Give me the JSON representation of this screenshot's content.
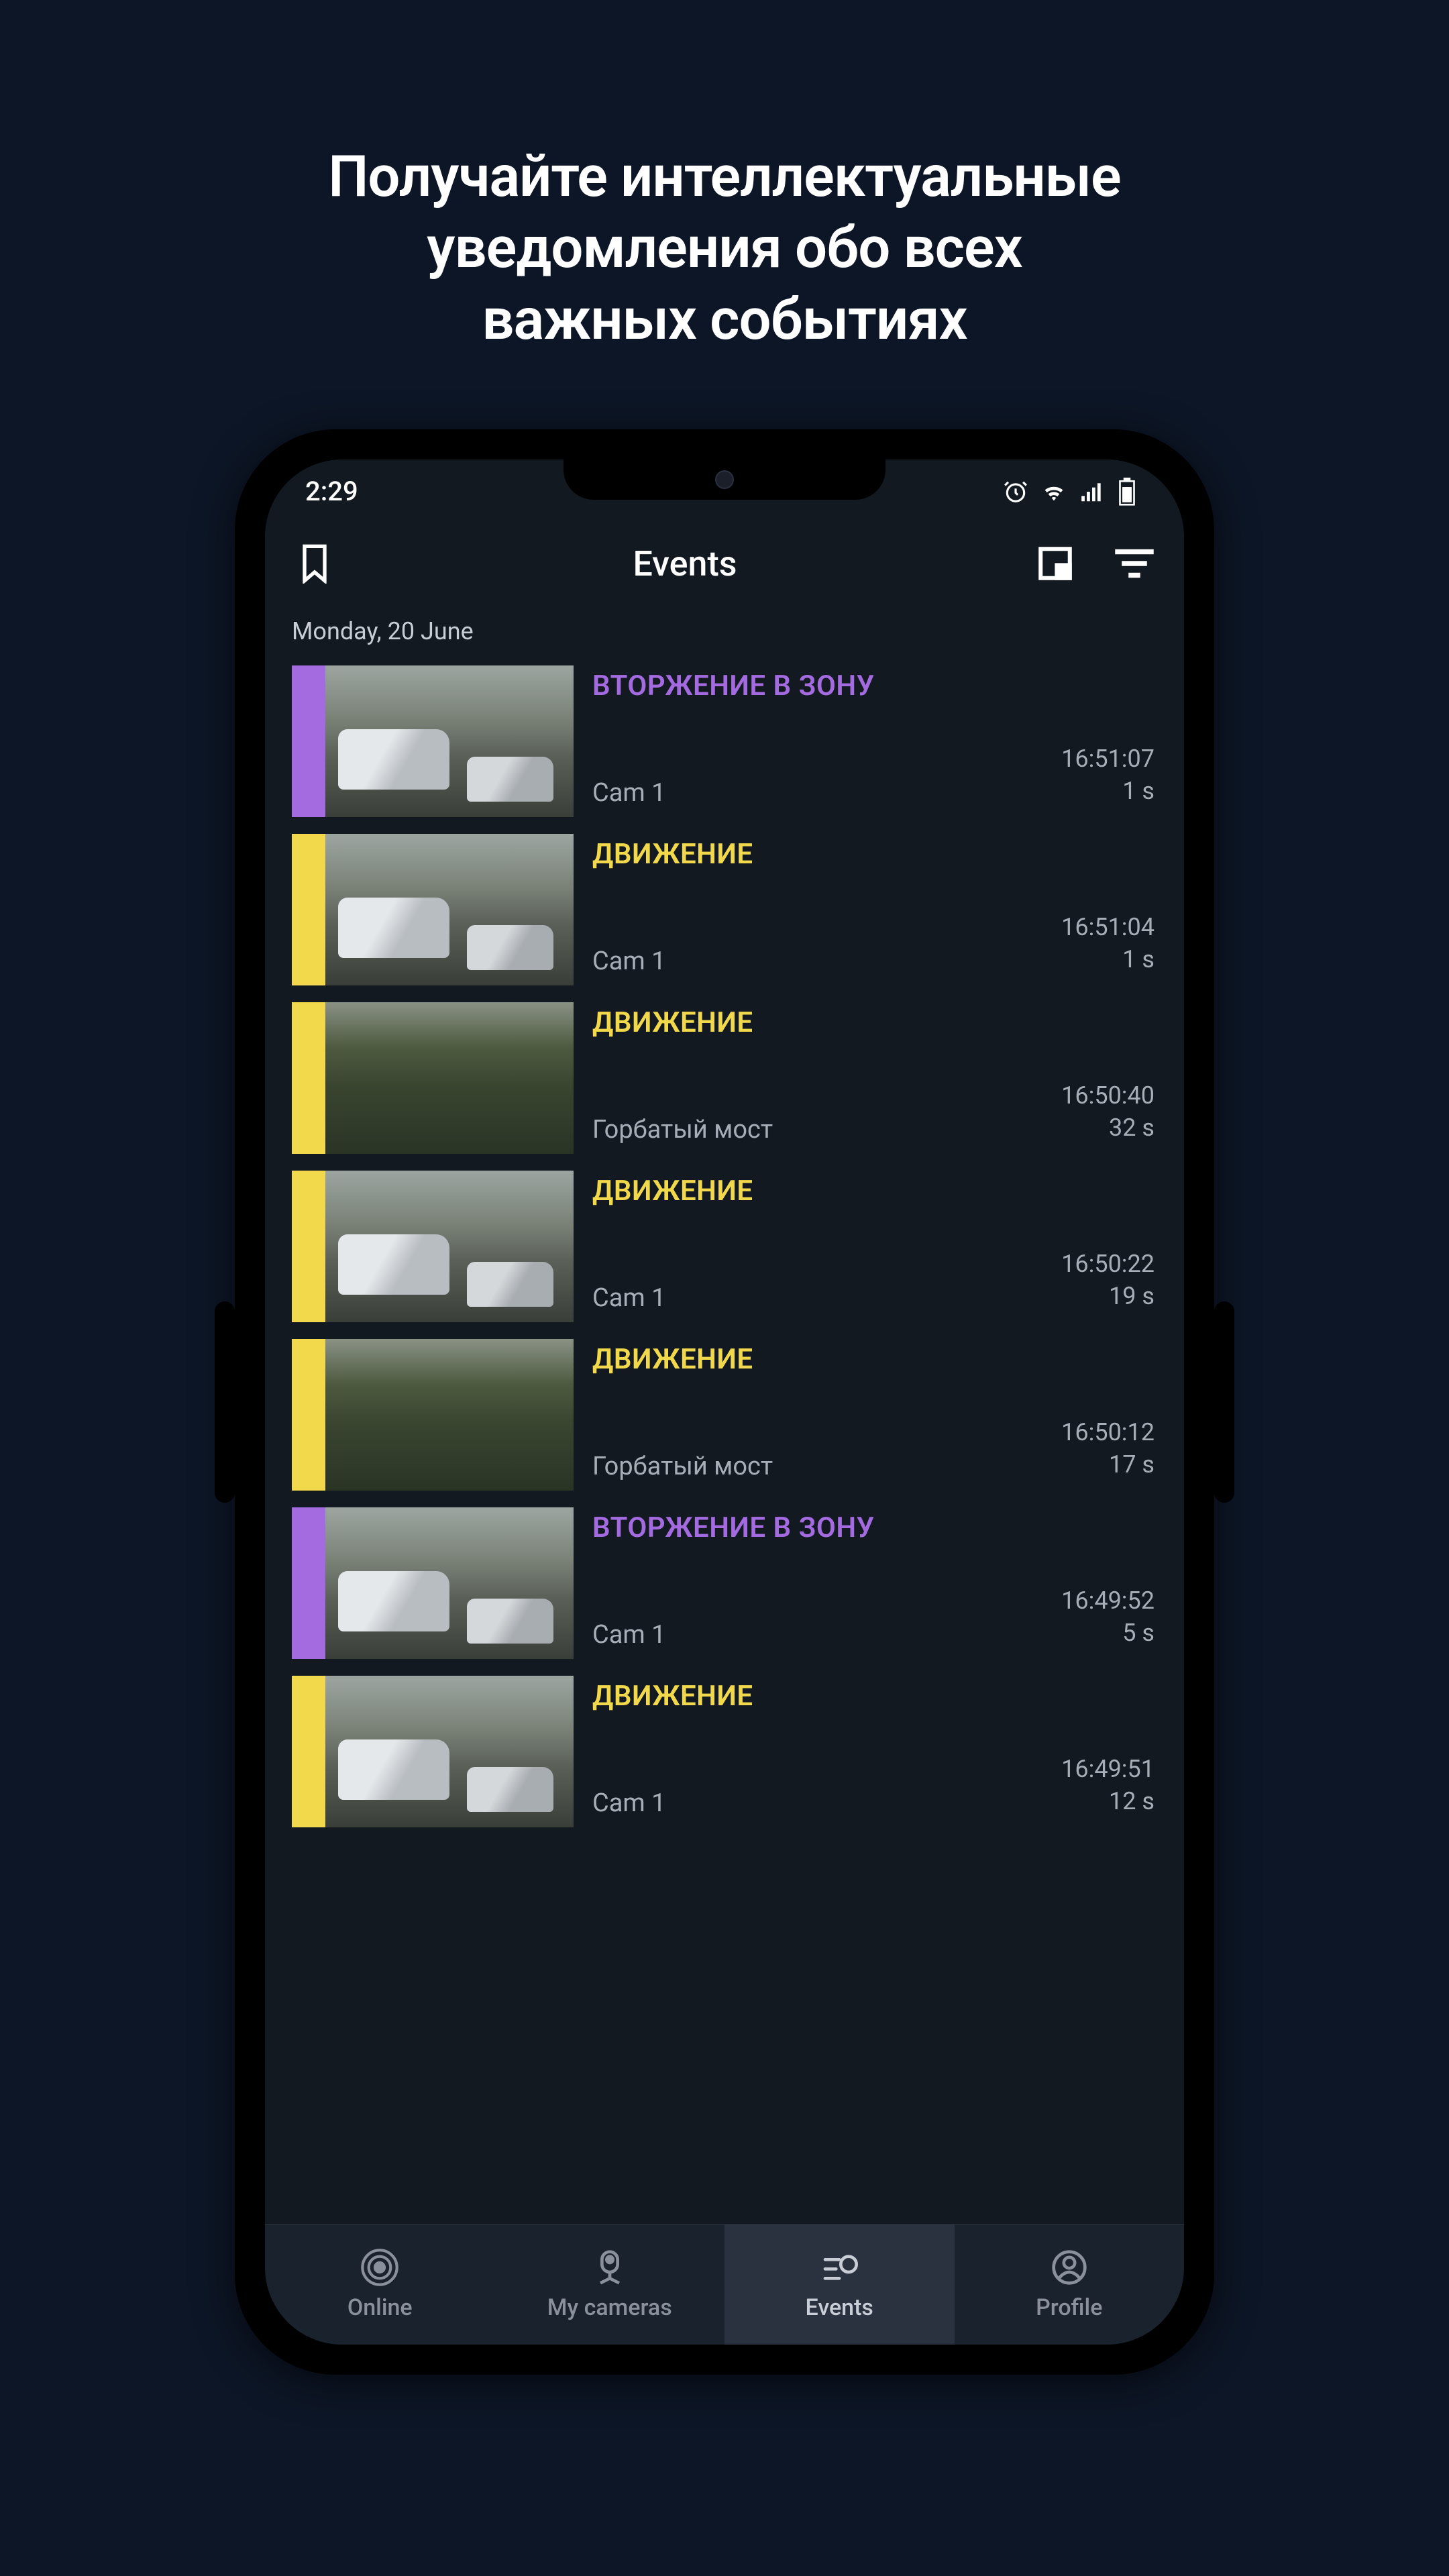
{
  "marketing": {
    "headline_l1": "Получайте интеллектуальные",
    "headline_l2": "уведомления обо всех",
    "headline_l3": "важных событиях"
  },
  "status": {
    "time": "2:29"
  },
  "header": {
    "title": "Events"
  },
  "date_header": "Monday, 20 June",
  "events": [
    {
      "type_label": "ВТОРЖЕНИЕ В ЗОНУ",
      "type": "intrusion",
      "camera": "Cam 1",
      "time": "16:51:07",
      "duration": "1 s",
      "scene": "street",
      "car2": true
    },
    {
      "type_label": "ДВИЖЕНИЕ",
      "type": "motion",
      "camera": "Cam 1",
      "time": "16:51:04",
      "duration": "1 s",
      "scene": "street",
      "car2": true
    },
    {
      "type_label": "ДВИЖЕНИЕ",
      "type": "motion",
      "camera": "Горбатый мост",
      "time": "16:50:40",
      "duration": "32 s",
      "scene": "park",
      "car2": false
    },
    {
      "type_label": "ДВИЖЕНИЕ",
      "type": "motion",
      "camera": "Cam 1",
      "time": "16:50:22",
      "duration": "19 s",
      "scene": "street",
      "car2": true
    },
    {
      "type_label": "ДВИЖЕНИЕ",
      "type": "motion",
      "camera": "Горбатый мост",
      "time": "16:50:12",
      "duration": "17 s",
      "scene": "park",
      "car2": false
    },
    {
      "type_label": "ВТОРЖЕНИЕ В ЗОНУ",
      "type": "intrusion",
      "camera": "Cam 1",
      "time": "16:49:52",
      "duration": "5 s",
      "scene": "street",
      "car2": true
    },
    {
      "type_label": "ДВИЖЕНИЕ",
      "type": "motion",
      "camera": "Cam 1",
      "time": "16:49:51",
      "duration": "12 s",
      "scene": "street",
      "car2": true
    }
  ],
  "tabs": [
    {
      "label": "Online",
      "active": false
    },
    {
      "label": "My cameras",
      "active": false
    },
    {
      "label": "Events",
      "active": true
    },
    {
      "label": "Profile",
      "active": false
    }
  ],
  "colors": {
    "intrusion": "#a46be0",
    "motion": "#f2d94c"
  }
}
